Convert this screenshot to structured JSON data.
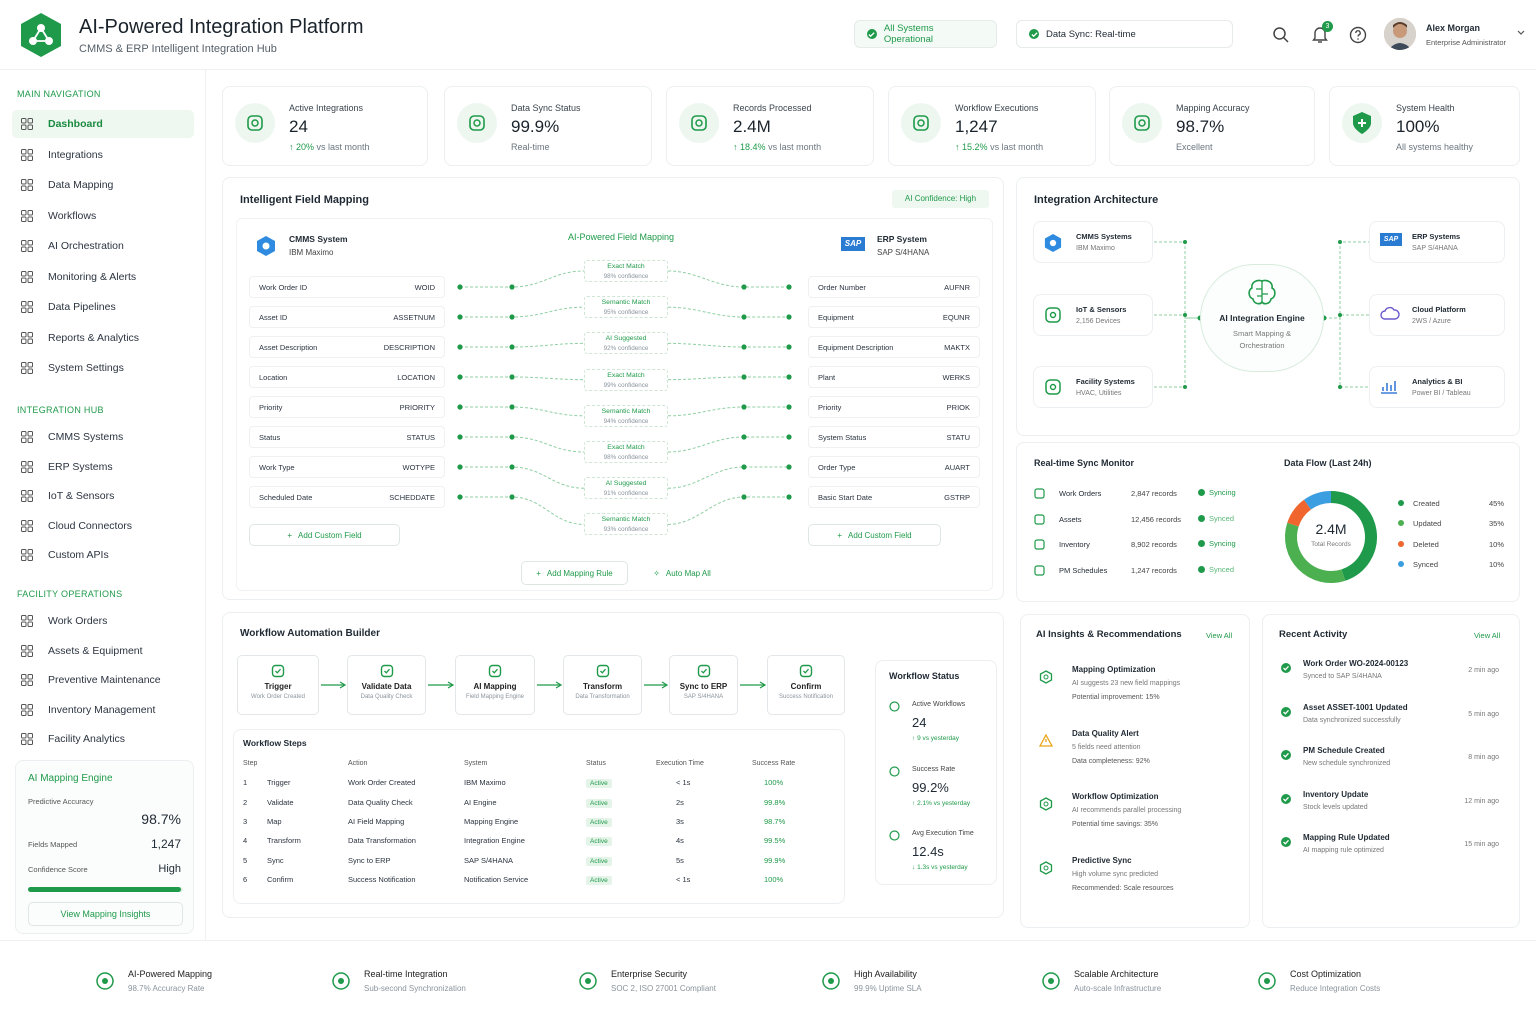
{
  "app": {
    "title": "AI-Powered Integration Platform",
    "subtitle": "CMMS & ERP Intelligent Integration Hub"
  },
  "header": {
    "status1": "All Systems Operational",
    "status2": "Data Sync: Real-time",
    "notifications": "3",
    "user_name": "Alex Morgan",
    "user_role": "Enterprise Administrator"
  },
  "sidebar": {
    "main_title": "MAIN NAVIGATION",
    "main": [
      {
        "label": "Dashboard",
        "icon": "grid-icon"
      },
      {
        "label": "Integrations",
        "icon": "grid-icon"
      },
      {
        "label": "Data Mapping",
        "icon": "nodes-icon"
      },
      {
        "label": "Workflows",
        "icon": "workflow-icon"
      },
      {
        "label": "AI Orchestration",
        "icon": "ai-icon"
      },
      {
        "label": "Monitoring & Alerts",
        "icon": "bell-icon"
      },
      {
        "label": "Data Pipelines",
        "icon": "pipeline-icon"
      },
      {
        "label": "Reports & Analytics",
        "icon": "report-icon"
      },
      {
        "label": "System Settings",
        "icon": "gear-icon"
      }
    ],
    "hub_title": "INTEGRATION HUB",
    "hub": [
      {
        "label": "CMMS Systems"
      },
      {
        "label": "ERP Systems"
      },
      {
        "label": "IoT & Sensors"
      },
      {
        "label": "Cloud Connectors"
      },
      {
        "label": "Custom APIs"
      }
    ],
    "fac_title": "FACILITY OPERATIONS",
    "fac": [
      {
        "label": "Work Orders"
      },
      {
        "label": "Assets & Equipment"
      },
      {
        "label": "Preventive Maintenance"
      },
      {
        "label": "Inventory Management"
      },
      {
        "label": "Facility Analytics"
      }
    ],
    "engine": {
      "title": "AI Mapping Engine",
      "acc_label": "Predictive Accuracy",
      "acc": "98.7%",
      "fields_label": "Fields Mapped",
      "fields": "1,247",
      "conf_label": "Confidence Score",
      "conf": "High",
      "progress": 0.987,
      "button": "View Mapping Insights"
    }
  },
  "kpis": [
    {
      "label": "Active Integrations",
      "value": "24",
      "delta": "20%",
      "sub": "vs last month",
      "icon": "integration-icon"
    },
    {
      "label": "Data Sync Status",
      "value": "99.9%",
      "delta": "",
      "sub": "Real-time",
      "icon": "sync-icon"
    },
    {
      "label": "Records Processed",
      "value": "2.4M",
      "delta": "18.4%",
      "sub": "vs last month",
      "icon": "records-icon"
    },
    {
      "label": "Workflow Executions",
      "value": "1,247",
      "delta": "15.2%",
      "sub": "vs last month",
      "icon": "workflow-icon"
    },
    {
      "label": "Mapping Accuracy",
      "value": "98.7%",
      "delta": "",
      "sub": "Excellent",
      "icon": "accuracy-icon"
    },
    {
      "label": "System Health",
      "value": "100%",
      "delta": "",
      "sub": "All systems healthy",
      "icon": "health-icon"
    }
  ],
  "mapping": {
    "title": "Intelligent Field Mapping",
    "confidence": "AI Confidence: High",
    "center_title": "AI-Powered Field Mapping",
    "source_title": "CMMS System",
    "source_sub": "IBM Maximo",
    "target_title": "ERP System",
    "target_sub": "SAP S/4HANA",
    "sap": "SAP",
    "source_fields": [
      [
        "Work Order ID",
        "WOID"
      ],
      [
        "Asset ID",
        "ASSETNUM"
      ],
      [
        "Asset Description",
        "DESCRIPTION"
      ],
      [
        "Location",
        "LOCATION"
      ],
      [
        "Priority",
        "PRIORITY"
      ],
      [
        "Status",
        "STATUS"
      ],
      [
        "Work Type",
        "WOTYPE"
      ],
      [
        "Scheduled Date",
        "SCHEDDATE"
      ]
    ],
    "target_fields": [
      [
        "Order Number",
        "AUFNR"
      ],
      [
        "Equipment",
        "EQUNR"
      ],
      [
        "Equipment Description",
        "MAKTX"
      ],
      [
        "Plant",
        "WERKS"
      ],
      [
        "Priority",
        "PRIOK"
      ],
      [
        "System Status",
        "STATU"
      ],
      [
        "Order Type",
        "AUART"
      ],
      [
        "Basic Start Date",
        "GSTRP"
      ]
    ],
    "matches": [
      [
        "Exact Match",
        "98% confidence"
      ],
      [
        "Semantic Match",
        "95% confidence"
      ],
      [
        "AI Suggested",
        "92% confidence"
      ],
      [
        "Exact Match",
        "99% confidence"
      ],
      [
        "Semantic Match",
        "94% confidence"
      ],
      [
        "Exact Match",
        "98% confidence"
      ],
      [
        "AI Suggested",
        "91% confidence"
      ],
      [
        "Semantic Match",
        "93% confidence"
      ]
    ],
    "add_left": "Add Custom Field",
    "add_right": "Add Custom Field",
    "add_rule": "Add Mapping Rule",
    "auto_map": "Auto Map All"
  },
  "architecture": {
    "title": "Integration Architecture",
    "nodes": [
      [
        "CMMS Systems",
        "IBM Maximo"
      ],
      [
        "IoT & Sensors",
        "2,156 Devices"
      ],
      [
        "Facility Systems",
        "HVAC, Utilities"
      ],
      [
        "ERP Systems",
        "SAP S/4HANA"
      ],
      [
        "Cloud Platform",
        "2WS / Azure"
      ],
      [
        "Analytics & BI",
        "Power BI / Tableau"
      ]
    ],
    "center_title": "AI Integration Engine",
    "center_sub": "Smart Mapping & Orchestration",
    "sap": "SAP"
  },
  "sync": {
    "title": "Real-time Sync Monitor",
    "rows": [
      [
        "Work Orders",
        "2,847 records",
        "Syncing"
      ],
      [
        "Assets",
        "12,456 records",
        "Synced"
      ],
      [
        "Inventory",
        "8,902 records",
        "Syncing"
      ],
      [
        "PM Schedules",
        "1,247 records",
        "Synced"
      ]
    ]
  },
  "chart_data": {
    "type": "pie",
    "title": "Data Flow (Last 24h)",
    "center_value": "2.4M",
    "center_label": "Total Records",
    "categories": [
      "Created",
      "Updated",
      "Deleted",
      "Synced"
    ],
    "values": [
      45,
      35,
      10,
      10
    ],
    "labels": [
      "45%",
      "35%",
      "10%",
      "10%"
    ],
    "colors": [
      "#1f9a4a",
      "#4caf50",
      "#f0652e",
      "#3b9ee0"
    ]
  },
  "workflow": {
    "title": "Workflow Automation Builder",
    "nodes": [
      [
        "Trigger",
        "Work Order Created"
      ],
      [
        "Validate Data",
        "Data Quality Check"
      ],
      [
        "AI Mapping",
        "Field Mapping Engine"
      ],
      [
        "Transform",
        "Data Transformation"
      ],
      [
        "Sync to ERP",
        "SAP S/4HANA"
      ],
      [
        "Confirm",
        "Success Notification"
      ]
    ],
    "steps_title": "Workflow Steps",
    "columns": [
      "Step",
      "Action",
      "System",
      "Status",
      "Execution Time",
      "Success Rate"
    ],
    "steps": [
      [
        "1",
        "Trigger",
        "Work Order Created",
        "IBM Maximo",
        "Active",
        "< 1s",
        "100%"
      ],
      [
        "2",
        "Validate",
        "Data Quality Check",
        "AI Engine",
        "Active",
        "2s",
        "99.8%"
      ],
      [
        "3",
        "Map",
        "AI Field Mapping",
        "Mapping Engine",
        "Active",
        "3s",
        "98.7%"
      ],
      [
        "4",
        "Transform",
        "Data Transformation",
        "Integration Engine",
        "Active",
        "4s",
        "99.5%"
      ],
      [
        "5",
        "Sync",
        "Sync to ERP",
        "SAP S/4HANA",
        "Active",
        "5s",
        "99.9%"
      ],
      [
        "6",
        "Confirm",
        "Success Notification",
        "Notification Service",
        "Active",
        "< 1s",
        "100%"
      ]
    ]
  },
  "wf_status": {
    "title": "Workflow Status",
    "items": [
      [
        "Active Workflows",
        "24",
        "9 vs yesterday"
      ],
      [
        "Success Rate",
        "99.2%",
        "2.1% vs yesterday"
      ],
      [
        "Avg Execution Time",
        "12.4s",
        "1.3s vs yesterday"
      ]
    ]
  },
  "insights": {
    "title": "AI Insights & Recommendations",
    "view_all": "View All",
    "items": [
      [
        "Mapping Optimization",
        "AI suggests 23 new field mappings",
        "Potential improvement: 15%"
      ],
      [
        "Data Quality Alert",
        "5 fields need attention",
        "Data completeness: 92%"
      ],
      [
        "Workflow Optimization",
        "AI recommends parallel processing",
        "Potential time savings: 35%"
      ],
      [
        "Predictive Sync",
        "High volume sync predicted",
        "Recommended: Scale resources"
      ]
    ]
  },
  "activity": {
    "title": "Recent Activity",
    "view_all": "View All",
    "items": [
      [
        "Work Order WO-2024-00123",
        "Synced to SAP S/4HANA",
        "2 min ago"
      ],
      [
        "Asset ASSET-1001 Updated",
        "Data synchronized successfully",
        "5 min ago"
      ],
      [
        "PM Schedule Created",
        "New schedule synchronized",
        "8 min ago"
      ],
      [
        "Inventory Update",
        "Stock levels updated",
        "12 min ago"
      ],
      [
        "Mapping Rule Updated",
        "AI mapping rule optimized",
        "15 min ago"
      ]
    ]
  },
  "footer": [
    [
      "AI-Powered Mapping",
      "98.7% Accuracy Rate"
    ],
    [
      "Real-time Integration",
      "Sub-second Synchronization"
    ],
    [
      "Enterprise Security",
      "SOC 2, ISO 27001 Compliant"
    ],
    [
      "High Availability",
      "99.9% Uptime SLA"
    ],
    [
      "Scalable Architecture",
      "Auto-scale Infrastructure"
    ],
    [
      "Cost Optimization",
      "Reduce Integration Costs"
    ]
  ]
}
